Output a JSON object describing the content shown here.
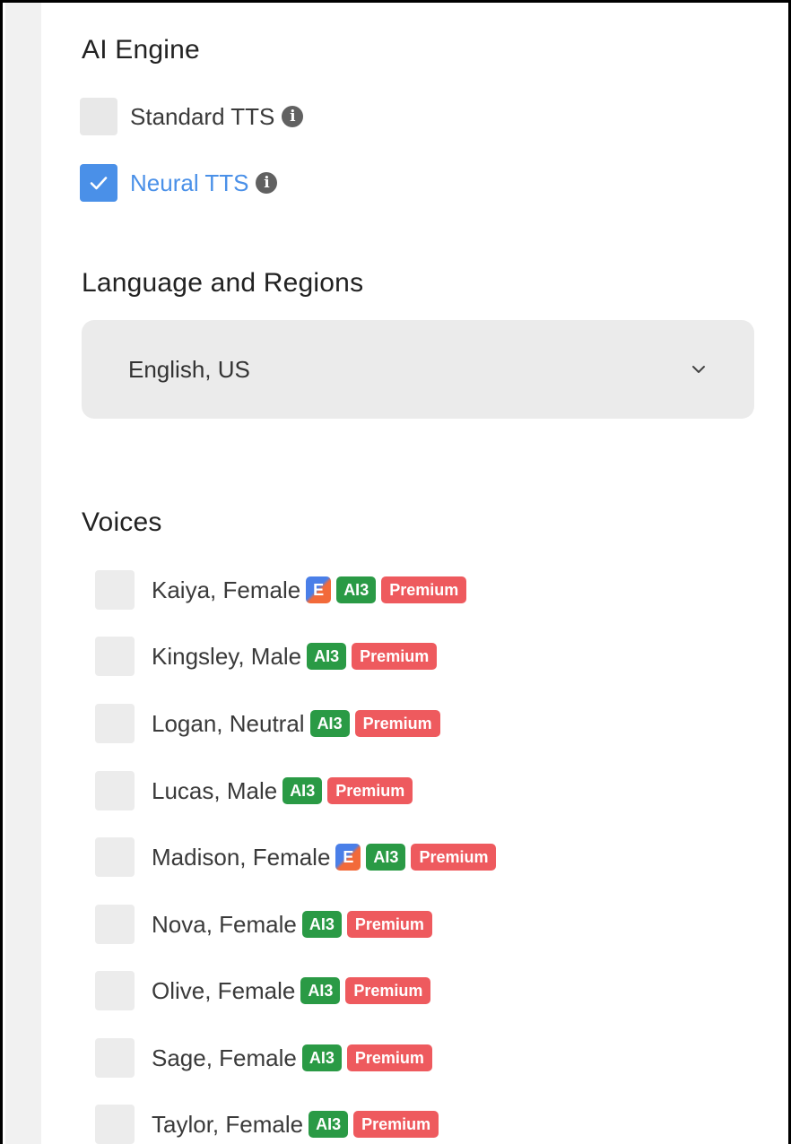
{
  "ai_engine": {
    "title": "AI Engine",
    "options": [
      {
        "label": "Standard TTS",
        "checked": false,
        "info_icon": "i"
      },
      {
        "label": "Neural TTS",
        "checked": true,
        "info_icon": "i"
      }
    ]
  },
  "language": {
    "title": "Language and Regions",
    "selected": "English, US"
  },
  "voices": {
    "title": "Voices",
    "items": [
      {
        "label": "Kaiya, Female",
        "e_badge": "E",
        "ai_badge": "AI3",
        "premium_badge": "Premium",
        "checked": false
      },
      {
        "label": "Kingsley, Male",
        "ai_badge": "AI3",
        "premium_badge": "Premium",
        "checked": false
      },
      {
        "label": "Logan, Neutral",
        "ai_badge": "AI3",
        "premium_badge": "Premium",
        "checked": false
      },
      {
        "label": "Lucas, Male",
        "ai_badge": "AI3",
        "premium_badge": "Premium",
        "checked": false
      },
      {
        "label": "Madison, Female",
        "e_badge": "E",
        "ai_badge": "AI3",
        "premium_badge": "Premium",
        "checked": false
      },
      {
        "label": "Nova, Female",
        "ai_badge": "AI3",
        "premium_badge": "Premium",
        "checked": false
      },
      {
        "label": "Olive, Female",
        "ai_badge": "AI3",
        "premium_badge": "Premium",
        "checked": false
      },
      {
        "label": "Sage, Female",
        "ai_badge": "AI3",
        "premium_badge": "Premium",
        "checked": false
      },
      {
        "label": "Taylor, Female",
        "ai_badge": "AI3",
        "premium_badge": "Premium",
        "checked": false
      }
    ]
  },
  "colors": {
    "accent_blue": "#4a90e8",
    "ai_badge_green": "#2a9a45",
    "premium_badge_red": "#ee5a5e"
  }
}
